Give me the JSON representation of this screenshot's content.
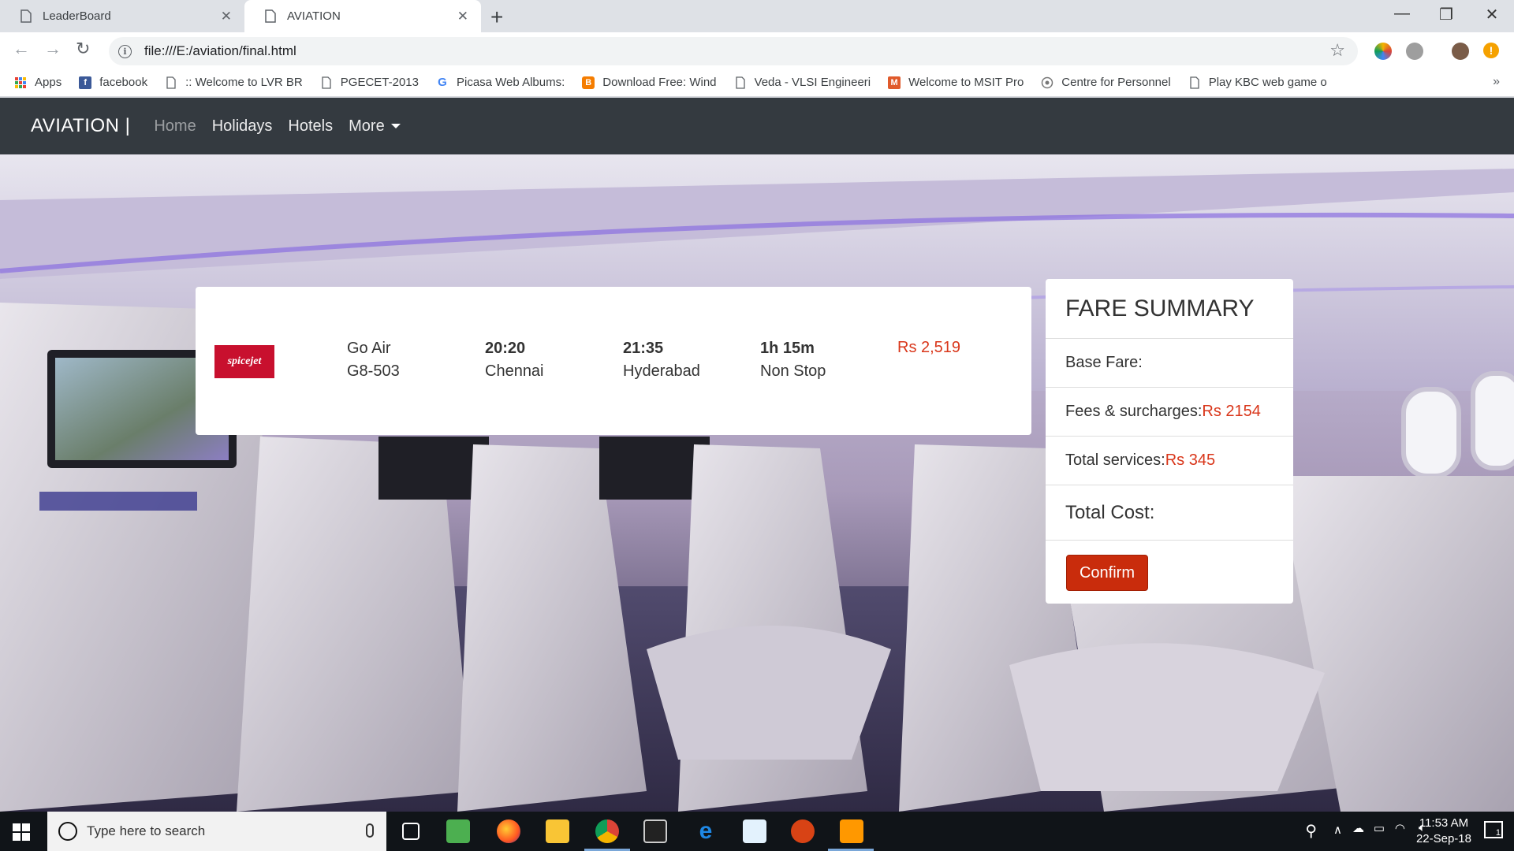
{
  "browser": {
    "tabs": [
      {
        "label": "LeaderBoard",
        "active": false
      },
      {
        "label": "AVIATION",
        "active": true
      }
    ],
    "url": "file:///E:/aviation/final.html",
    "bookmarks": [
      {
        "label": "Apps",
        "icon": "apps-grid-icon"
      },
      {
        "label": "facebook",
        "icon": "facebook-icon"
      },
      {
        "label": ":: Welcome to LVR BR",
        "icon": "page-icon"
      },
      {
        "label": "PGECET-2013",
        "icon": "page-icon"
      },
      {
        "label": "Picasa Web Albums:",
        "icon": "google-icon"
      },
      {
        "label": "Download Free: Wind",
        "icon": "blogger-icon"
      },
      {
        "label": "Veda - VLSI Engineeri",
        "icon": "page-icon"
      },
      {
        "label": "Welcome to MSIT Pro",
        "icon": "msit-icon"
      },
      {
        "label": "Centre for Personnel",
        "icon": "emblem-icon"
      },
      {
        "label": "Play KBC web game o",
        "icon": "page-icon"
      }
    ]
  },
  "navbar": {
    "brand": "AVIATION |",
    "links": [
      "Home",
      "Holidays",
      "Hotels",
      "More"
    ]
  },
  "flight": {
    "airline_logo_text": "spicejet",
    "airline": "Go Air",
    "flight_no": "G8-503",
    "depart_time": "20:20",
    "depart_city": "Chennai",
    "arrive_time": "21:35",
    "arrive_city": "Hyderabad",
    "duration": "1h 15m",
    "stops": "Non Stop",
    "price": "Rs 2,519"
  },
  "fare_summary": {
    "title": "FARE SUMMARY",
    "base_fare_label": "Base Fare:",
    "fees_label": "Fees & surcharges:",
    "fees_value": "Rs 2154",
    "services_label": "Total services:",
    "services_value": "Rs 345",
    "total_label": "Total Cost:",
    "confirm_label": "Confirm"
  },
  "taskbar": {
    "search_placeholder": "Type here to search",
    "time": "11:53 AM",
    "date": "22-Sep-18",
    "notification_count": "1"
  },
  "colors": {
    "navbar_bg": "#343a40",
    "price_red": "#d9361a",
    "confirm_bg": "#c92c0c"
  }
}
